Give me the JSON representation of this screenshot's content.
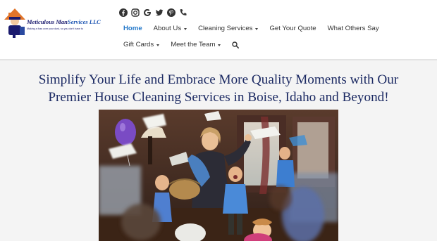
{
  "logo": {
    "name_part1": "Meticulous Man",
    "name_part2": "Services LLC",
    "tagline": "Making a fuss over your dust, so you don't have to"
  },
  "social": {
    "icons": [
      "facebook-icon",
      "instagram-icon",
      "google-icon",
      "twitter-icon",
      "pinterest-icon",
      "phone-icon"
    ]
  },
  "nav": {
    "row1": [
      {
        "label": "Home",
        "active": true,
        "dropdown": false
      },
      {
        "label": "About Us",
        "active": false,
        "dropdown": true
      },
      {
        "label": "Cleaning Services",
        "active": false,
        "dropdown": true
      },
      {
        "label": "Get Your Quote",
        "active": false,
        "dropdown": false
      },
      {
        "label": "What Others Say",
        "active": false,
        "dropdown": false
      }
    ],
    "row2": [
      {
        "label": "Gift Cards",
        "active": false,
        "dropdown": true
      },
      {
        "label": "Meet the Team",
        "active": false,
        "dropdown": true
      }
    ]
  },
  "hero": {
    "headline_line1": "Simplify Your Life and Embrace More Quality Moments with Our",
    "headline_line2": "Premier House Cleaning Services in Boise, Idaho and Beyond!"
  },
  "colors": {
    "active_nav": "#2277c9",
    "headline": "#1c2a63",
    "logo_navy": "#1a1a6e"
  }
}
